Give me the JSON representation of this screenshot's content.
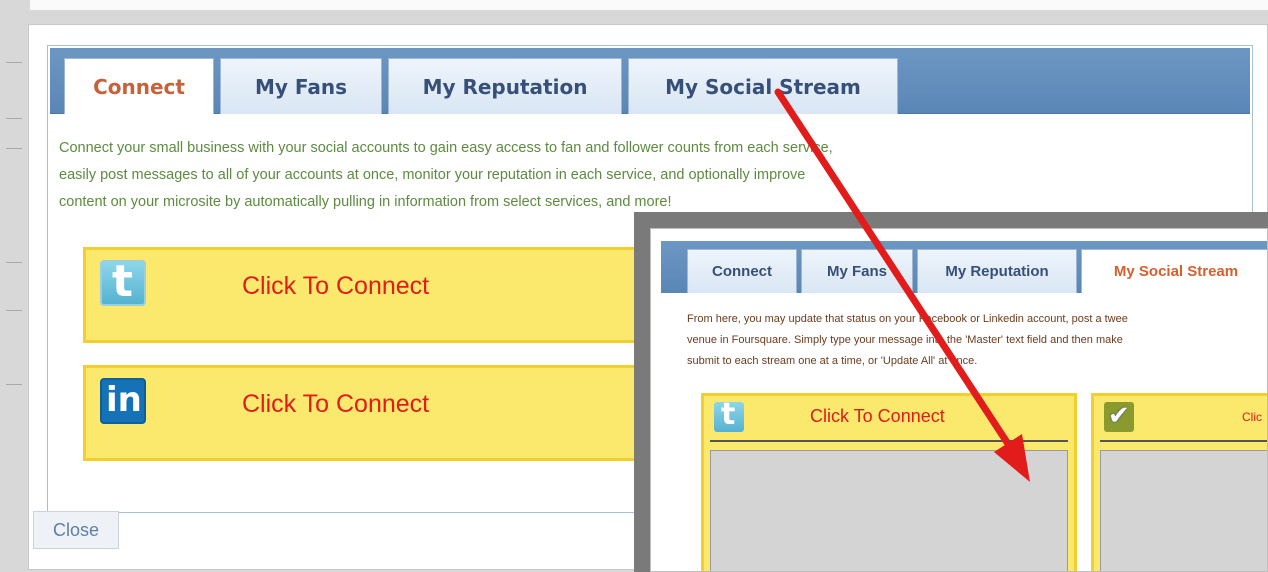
{
  "colors": {
    "tab_active_text": "#c8603a",
    "tab_text": "#36507a",
    "tabbar": "#5a86b6",
    "intro_text": "#5d8a40",
    "connect_box_bg": "#fbe96e",
    "connect_box_border": "#f2cf2c",
    "connect_label": "#e21b1b",
    "annotation_arrow": "#e21b1b"
  },
  "main_dialog": {
    "tabs": [
      {
        "label": "Connect",
        "active": true
      },
      {
        "label": "My Fans",
        "active": false
      },
      {
        "label": "My Reputation",
        "active": false
      },
      {
        "label": "My Social Stream",
        "active": false
      }
    ],
    "intro_lines": [
      "Connect your small business with your social accounts to gain easy access to fan and follower counts from each service,",
      "easily post messages to all of your accounts at once, monitor your reputation in each service, and optionally improve",
      "content on your microsite by automatically pulling in information from select services, and more!"
    ],
    "services": [
      {
        "icon": "twitter-icon",
        "label": "Click To Connect"
      },
      {
        "icon": "linkedin-icon",
        "label": "Click To Connect"
      }
    ],
    "close_label": "Close"
  },
  "overlay": {
    "tabs": [
      {
        "label": "Connect",
        "active": false
      },
      {
        "label": "My Fans",
        "active": false
      },
      {
        "label": "My Reputation",
        "active": false
      },
      {
        "label": "My Social Stream",
        "active": true
      }
    ],
    "intro_lines": [
      "From here, you may update that status on your Facebook or Linkedin account, post a twee",
      "venue in Foursquare. Simply type your message into the 'Master' text field and then make",
      "submit to each stream one at a time, or 'Update All' at once."
    ],
    "streams": [
      {
        "icon": "twitter-icon",
        "label": "Click To Connect"
      },
      {
        "icon": "foursquare-icon",
        "label": "Clic"
      }
    ]
  }
}
